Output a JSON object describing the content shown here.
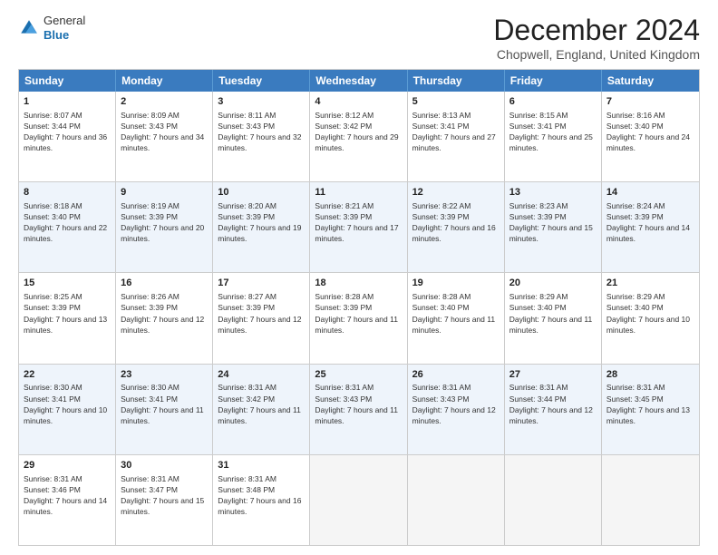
{
  "header": {
    "logo": {
      "general": "General",
      "blue": "Blue"
    },
    "title": "December 2024",
    "subtitle": "Chopwell, England, United Kingdom"
  },
  "days": [
    "Sunday",
    "Monday",
    "Tuesday",
    "Wednesday",
    "Thursday",
    "Friday",
    "Saturday"
  ],
  "weeks": [
    [
      {
        "day": 1,
        "rise": "8:07 AM",
        "set": "3:44 PM",
        "daylight": "7 hours and 36 minutes"
      },
      {
        "day": 2,
        "rise": "8:09 AM",
        "set": "3:43 PM",
        "daylight": "7 hours and 34 minutes"
      },
      {
        "day": 3,
        "rise": "8:11 AM",
        "set": "3:43 PM",
        "daylight": "7 hours and 32 minutes"
      },
      {
        "day": 4,
        "rise": "8:12 AM",
        "set": "3:42 PM",
        "daylight": "7 hours and 29 minutes"
      },
      {
        "day": 5,
        "rise": "8:13 AM",
        "set": "3:41 PM",
        "daylight": "7 hours and 27 minutes"
      },
      {
        "day": 6,
        "rise": "8:15 AM",
        "set": "3:41 PM",
        "daylight": "7 hours and 25 minutes"
      },
      {
        "day": 7,
        "rise": "8:16 AM",
        "set": "3:40 PM",
        "daylight": "7 hours and 24 minutes"
      }
    ],
    [
      {
        "day": 8,
        "rise": "8:18 AM",
        "set": "3:40 PM",
        "daylight": "7 hours and 22 minutes"
      },
      {
        "day": 9,
        "rise": "8:19 AM",
        "set": "3:39 PM",
        "daylight": "7 hours and 20 minutes"
      },
      {
        "day": 10,
        "rise": "8:20 AM",
        "set": "3:39 PM",
        "daylight": "7 hours and 19 minutes"
      },
      {
        "day": 11,
        "rise": "8:21 AM",
        "set": "3:39 PM",
        "daylight": "7 hours and 17 minutes"
      },
      {
        "day": 12,
        "rise": "8:22 AM",
        "set": "3:39 PM",
        "daylight": "7 hours and 16 minutes"
      },
      {
        "day": 13,
        "rise": "8:23 AM",
        "set": "3:39 PM",
        "daylight": "7 hours and 15 minutes"
      },
      {
        "day": 14,
        "rise": "8:24 AM",
        "set": "3:39 PM",
        "daylight": "7 hours and 14 minutes"
      }
    ],
    [
      {
        "day": 15,
        "rise": "8:25 AM",
        "set": "3:39 PM",
        "daylight": "7 hours and 13 minutes"
      },
      {
        "day": 16,
        "rise": "8:26 AM",
        "set": "3:39 PM",
        "daylight": "7 hours and 12 minutes"
      },
      {
        "day": 17,
        "rise": "8:27 AM",
        "set": "3:39 PM",
        "daylight": "7 hours and 12 minutes"
      },
      {
        "day": 18,
        "rise": "8:28 AM",
        "set": "3:39 PM",
        "daylight": "7 hours and 11 minutes"
      },
      {
        "day": 19,
        "rise": "8:28 AM",
        "set": "3:40 PM",
        "daylight": "7 hours and 11 minutes"
      },
      {
        "day": 20,
        "rise": "8:29 AM",
        "set": "3:40 PM",
        "daylight": "7 hours and 11 minutes"
      },
      {
        "day": 21,
        "rise": "8:29 AM",
        "set": "3:40 PM",
        "daylight": "7 hours and 10 minutes"
      }
    ],
    [
      {
        "day": 22,
        "rise": "8:30 AM",
        "set": "3:41 PM",
        "daylight": "7 hours and 10 minutes"
      },
      {
        "day": 23,
        "rise": "8:30 AM",
        "set": "3:41 PM",
        "daylight": "7 hours and 11 minutes"
      },
      {
        "day": 24,
        "rise": "8:31 AM",
        "set": "3:42 PM",
        "daylight": "7 hours and 11 minutes"
      },
      {
        "day": 25,
        "rise": "8:31 AM",
        "set": "3:43 PM",
        "daylight": "7 hours and 11 minutes"
      },
      {
        "day": 26,
        "rise": "8:31 AM",
        "set": "3:43 PM",
        "daylight": "7 hours and 12 minutes"
      },
      {
        "day": 27,
        "rise": "8:31 AM",
        "set": "3:44 PM",
        "daylight": "7 hours and 12 minutes"
      },
      {
        "day": 28,
        "rise": "8:31 AM",
        "set": "3:45 PM",
        "daylight": "7 hours and 13 minutes"
      }
    ],
    [
      {
        "day": 29,
        "rise": "8:31 AM",
        "set": "3:46 PM",
        "daylight": "7 hours and 14 minutes"
      },
      {
        "day": 30,
        "rise": "8:31 AM",
        "set": "3:47 PM",
        "daylight": "7 hours and 15 minutes"
      },
      {
        "day": 31,
        "rise": "8:31 AM",
        "set": "3:48 PM",
        "daylight": "7 hours and 16 minutes"
      },
      null,
      null,
      null,
      null
    ]
  ]
}
